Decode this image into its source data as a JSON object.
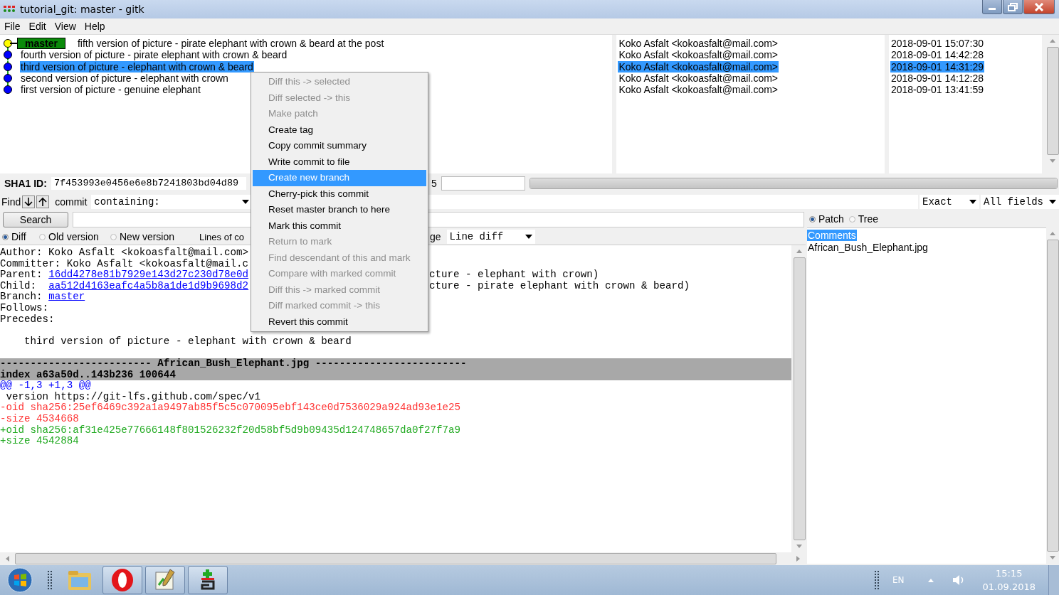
{
  "window": {
    "title": "tutorial_git: master - gitk"
  },
  "menu": [
    "File",
    "Edit",
    "View",
    "Help"
  ],
  "commits": [
    {
      "subject": "fifth version of picture - pirate elephant with crown & beard at the post",
      "tag": "master",
      "author": "Koko Asfalt <kokoasfalt@mail.com>",
      "date": "2018-09-01 15:07:30",
      "selected": false,
      "color": "#ffff00"
    },
    {
      "subject": "fourth version of picture - pirate elephant with crown & beard",
      "author": "Koko Asfalt <kokoasfalt@mail.com>",
      "date": "2018-09-01 14:42:28",
      "selected": false,
      "color": "#0000ff"
    },
    {
      "subject": "third version of picture - elephant with crown & beard",
      "author": "Koko Asfalt <kokoasfalt@mail.com>",
      "date": "2018-09-01 14:31:29",
      "selected": true,
      "color": "#0000ff"
    },
    {
      "subject": "second version of picture - elephant with crown",
      "author": "Koko Asfalt <kokoasfalt@mail.com>",
      "date": "2018-09-01 14:12:28",
      "selected": false,
      "color": "#0000ff"
    },
    {
      "subject": "first version of picture - genuine elephant",
      "author": "Koko Asfalt <kokoasfalt@mail.com>",
      "date": "2018-09-01 13:41:59",
      "selected": false,
      "color": "#0000ff"
    }
  ],
  "sha": {
    "label": "SHA1 ID:",
    "value": "7f453993e0456e6e8b7241803bd04d89",
    "row_count": "5"
  },
  "progress": {
    "level": 1
  },
  "find": {
    "label": "Find",
    "type_label": "commit",
    "mode": "containing:",
    "match": "Exact",
    "fields": "All fields"
  },
  "search_button": "Search",
  "diff_modes": [
    {
      "label": "Diff",
      "selected": true
    },
    {
      "label": "Old version",
      "selected": false
    },
    {
      "label": "New version",
      "selected": false
    }
  ],
  "lines_of_context": "Lines of co",
  "ignore_space": "ge",
  "diff_style": "Line diff",
  "header_lines": [
    {
      "kind": "plain",
      "text": "Author: Koko Asfalt <kokoasfalt@mail.com>"
    },
    {
      "kind": "plain",
      "text": "Committer: Koko Asfalt <kokoasfalt@mail.c"
    },
    {
      "kind": "link",
      "label": "Parent: ",
      "link": "16dd4278e81b7929e143d27c230d78e0d",
      "tail": "cture - elephant with crown)"
    },
    {
      "kind": "link",
      "label": "Child:  ",
      "link": "aa512d4163eafc4a5b8a1de1d9b9698d2",
      "tail": "cture - pirate elephant with crown & beard)"
    },
    {
      "kind": "link",
      "label": "Branch: ",
      "link": "master"
    },
    {
      "kind": "plain",
      "text": "Follows:"
    },
    {
      "kind": "plain",
      "text": "Precedes:"
    },
    {
      "kind": "blank"
    },
    {
      "kind": "plain",
      "text": "    third version of picture - elephant with crown & beard"
    },
    {
      "kind": "blank"
    }
  ],
  "diff_lines": [
    {
      "kind": "file",
      "text": "------------------------- African_Bush_Elephant.jpg -------------------------"
    },
    {
      "kind": "index",
      "text": "index a63a50d..143b236 100644"
    },
    {
      "kind": "hunk",
      "text": "@@ -1,3 +1,3 @@"
    },
    {
      "kind": "context",
      "text": " version https://git-lfs.github.com/spec/v1"
    },
    {
      "kind": "removed",
      "text": "-oid sha256:25ef6469c392a1a9497ab85f5c5c070095ebf143ce0d7536029a924ad93e1e25"
    },
    {
      "kind": "removed",
      "text": "-size 4534668"
    },
    {
      "kind": "added",
      "text": "+oid sha256:af31e425e77666148f801526232f20d58bf5d9b09435d124748657da0f27f7a9"
    },
    {
      "kind": "added",
      "text": "+size 4542884"
    }
  ],
  "view_modes": [
    {
      "label": "Patch",
      "selected": true
    },
    {
      "label": "Tree",
      "selected": false
    }
  ],
  "files": [
    {
      "name": "Comments",
      "selected": true
    },
    {
      "name": "African_Bush_Elephant.jpg",
      "selected": false
    }
  ],
  "context_menu": [
    {
      "label": "Diff this -> selected",
      "disabled": true,
      "selected": false
    },
    {
      "label": "Diff selected -> this",
      "disabled": true,
      "selected": false
    },
    {
      "label": "Make patch",
      "disabled": true,
      "selected": false
    },
    {
      "label": "Create tag",
      "disabled": false,
      "selected": false
    },
    {
      "label": "Copy commit summary",
      "disabled": false,
      "selected": false
    },
    {
      "label": "Write commit to file",
      "disabled": false,
      "selected": false
    },
    {
      "label": "Create new branch",
      "disabled": false,
      "selected": true
    },
    {
      "label": "Cherry-pick this commit",
      "disabled": false,
      "selected": false
    },
    {
      "label": "Reset master branch to here",
      "disabled": false,
      "selected": false
    },
    {
      "label": "Mark this commit",
      "disabled": false,
      "selected": false
    },
    {
      "label": "Return to mark",
      "disabled": true,
      "selected": false
    },
    {
      "label": "Find descendant of this and mark",
      "disabled": true,
      "selected": false
    },
    {
      "label": "Compare with marked commit",
      "disabled": true,
      "selected": false
    },
    {
      "label": "Diff this -> marked commit",
      "disabled": true,
      "selected": false
    },
    {
      "label": "Diff marked commit -> this",
      "disabled": true,
      "selected": false
    },
    {
      "label": "Revert this commit",
      "disabled": false,
      "selected": false
    }
  ],
  "taskbar": {
    "language": "EN",
    "time": "15:15",
    "date": "01.09.2018"
  }
}
